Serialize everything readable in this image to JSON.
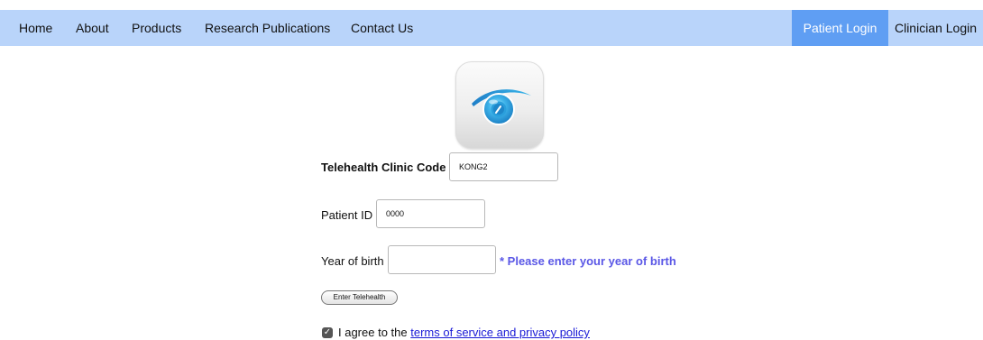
{
  "nav": {
    "items": [
      "Home",
      "About",
      "Products",
      "Research Publications",
      "Contact Us"
    ],
    "patient_login": "Patient Login",
    "clinician_login": "Clinician Login"
  },
  "form": {
    "clinic_code_label": "Telehealth Clinic Code",
    "clinic_code_value": "KONG2",
    "patient_id_label": "Patient ID",
    "patient_id_value": "0000",
    "year_label": "Year of birth",
    "year_value": "",
    "year_hint": "* Please enter your year of birth",
    "enter_button": "Enter Telehealth",
    "agree_prefix": "I agree to the",
    "terms_link": "terms of service and privacy policy",
    "agree_checked": true
  },
  "colors": {
    "nav_bg": "#b9d4fa",
    "active_tab_bg": "#5f9ef3",
    "hint_text": "#5a57e6",
    "link": "#1a1ad6"
  },
  "logo_icon": "eye-icon"
}
